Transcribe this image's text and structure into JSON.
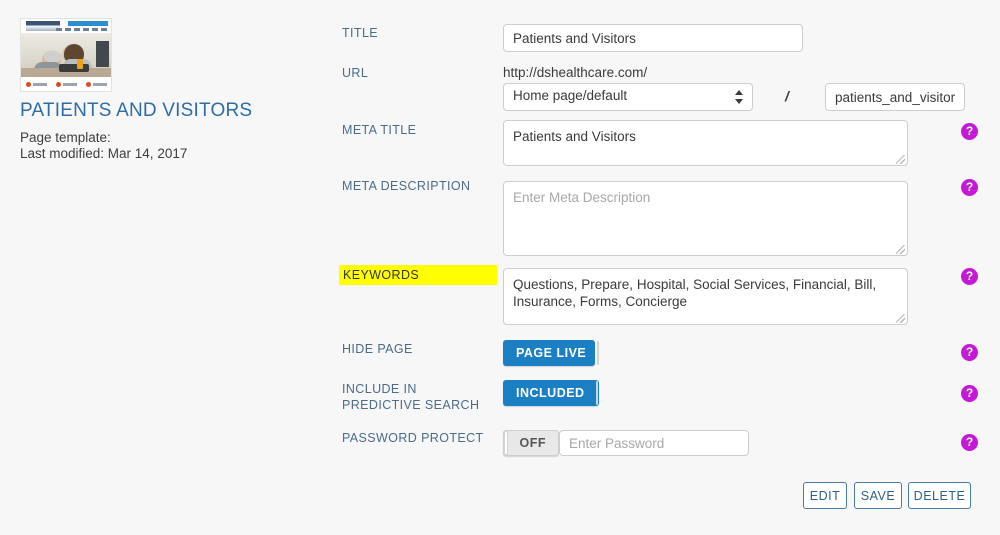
{
  "left_panel": {
    "thumbnail_alt": "page-thumbnail-preview",
    "page_title": "PATIENTS AND VISITORS",
    "page_template_label": "Page template:",
    "last_modified_label": "Last modified: Mar 14, 2017",
    "title_color": "#2e6da4"
  },
  "form": {
    "title": {
      "label": "TITLE",
      "value": "Patients and Visitors"
    },
    "url": {
      "label": "URL",
      "base": "http://dshealthcare.com/",
      "parent_selected": "Home page/default",
      "separator": "/",
      "slug": "patients_and_visitors"
    },
    "meta_title": {
      "label": "META TITLE",
      "value": "Patients and Visitors"
    },
    "meta_description": {
      "label": "META DESCRIPTION",
      "value": "",
      "placeholder": "Enter Meta Description"
    },
    "keywords": {
      "label": "KEYWORDS",
      "highlight_color": "#ffff00",
      "value": "Questions, Prepare, Hospital, Social Services, Financial, Bill, Insurance, Forms, Concierge"
    },
    "hide_page": {
      "label": "HIDE PAGE",
      "toggle_state": "on",
      "toggle_label": "PAGE LIVE"
    },
    "predictive_search": {
      "label": "INCLUDE IN PREDICTIVE SEARCH",
      "toggle_state": "on",
      "toggle_label": "INCLUDED"
    },
    "password_protect": {
      "label": "PASSWORD PROTECT",
      "toggle_state": "off",
      "toggle_label": "OFF",
      "password_placeholder": "Enter Password",
      "password_value": ""
    },
    "help_icon_glyph": "?",
    "help_icon_color": "#c41ad6"
  },
  "actions": {
    "edit": "EDIT",
    "save": "SAVE",
    "delete": "DELETE"
  }
}
